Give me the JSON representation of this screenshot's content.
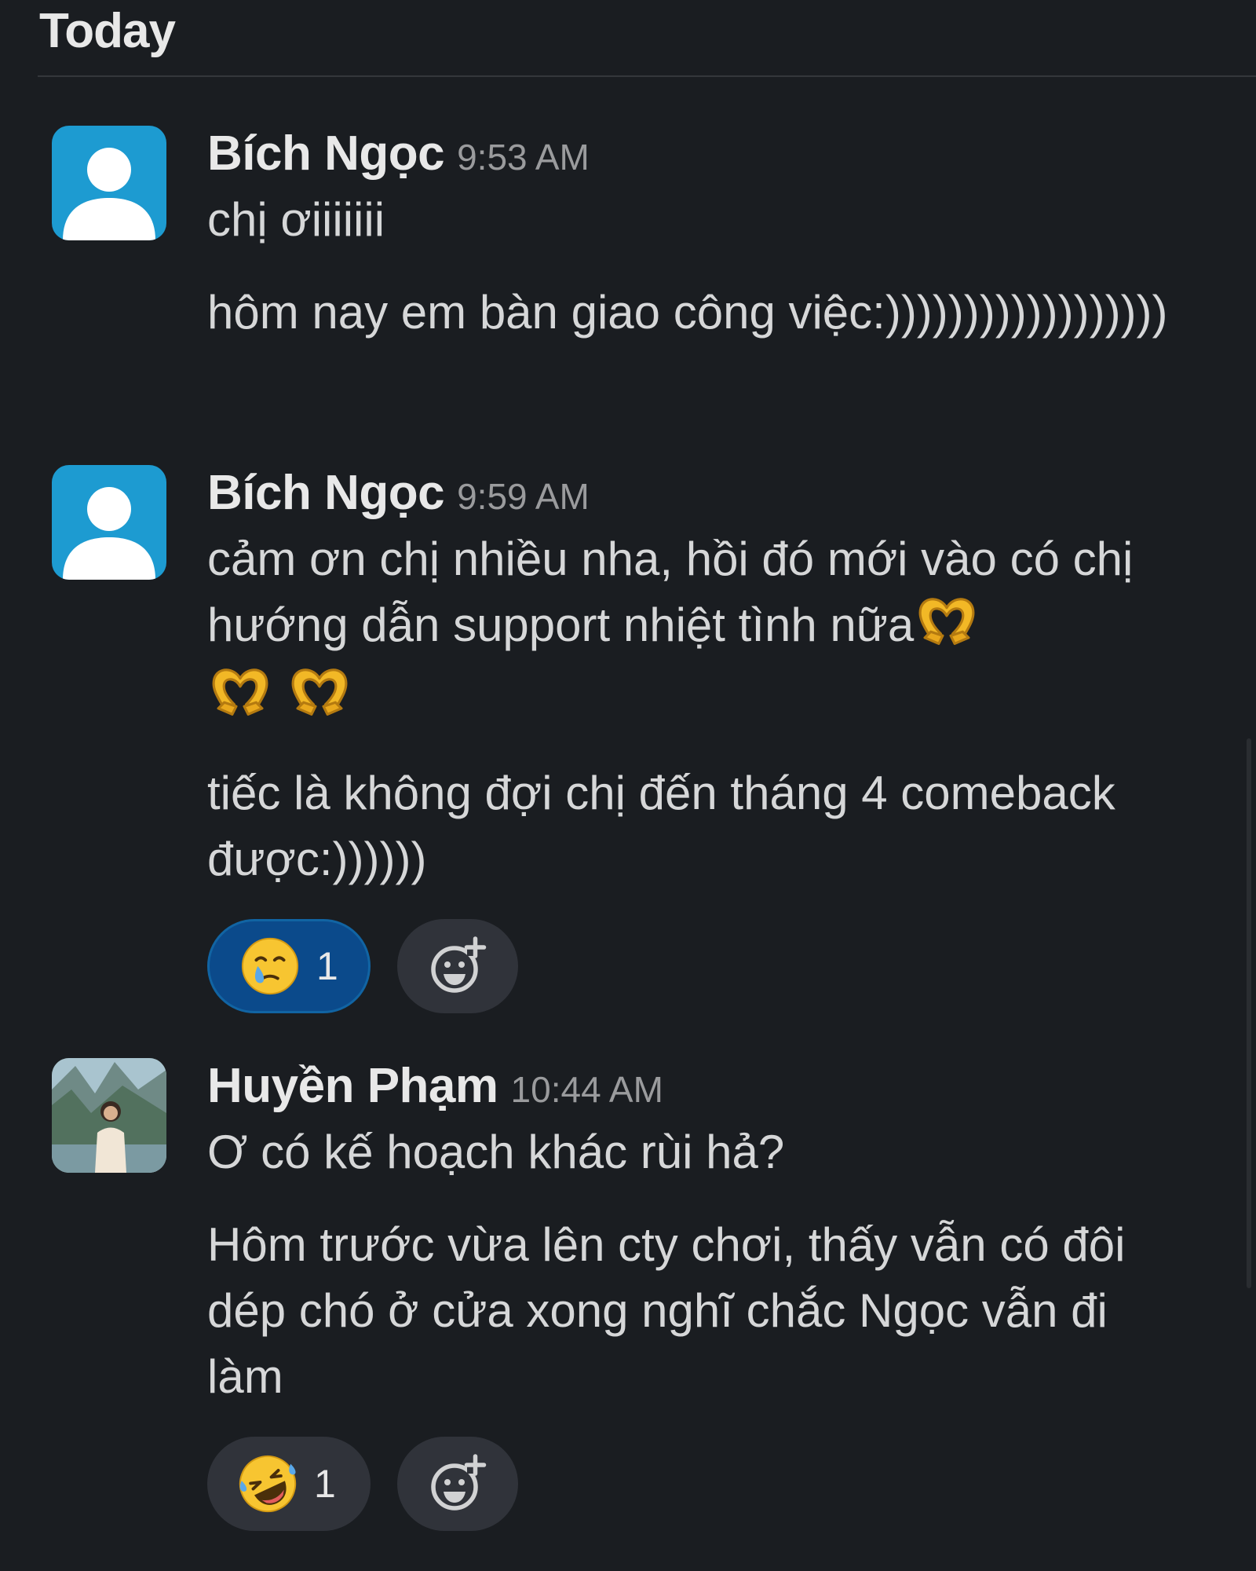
{
  "day_label": "Today",
  "messages": [
    {
      "sender": "Bích Ngọc",
      "time": "9:53 AM",
      "avatar": "default-user-icon",
      "paragraphs": [
        "chị ơiiiiiii",
        "hôm nay em bàn giao công việc:))))))))))))))))))"
      ]
    },
    {
      "sender": "Bích Ngọc",
      "time": "9:59 AM",
      "avatar": "default-user-icon",
      "paragraphs": [
        "cảm ơn chị nhiều nha, hồi đó mới vào có chị hướng dẫn support nhiệt tình nữa",
        "tiếc là không đợi chị đến tháng 4 comeback được:))))))"
      ],
      "inline_emoji": "heart-hands-emoji",
      "reactions": [
        {
          "emoji": "face-holding-back-tears-emoji",
          "count": "1",
          "active": true
        }
      ]
    },
    {
      "sender": "Huyền Phạm",
      "time": "10:44 AM",
      "avatar": "profile-photo",
      "paragraphs": [
        "Ơ có kế hoạch khác rùi hả?",
        "Hôm trước vừa lên cty chơi, thấy vẫn có đôi dép chó ở cửa xong nghĩ chắc Ngọc vẫn đi làm"
      ],
      "reactions": [
        {
          "emoji": "rolling-on-floor-laughing-emoji",
          "count": "1",
          "active": false
        }
      ]
    }
  ],
  "colors": {
    "background": "#1a1d21",
    "avatar_blue": "#1d9bd1",
    "active_reaction": "#0b4a8b",
    "reaction_pill": "#30333a"
  }
}
